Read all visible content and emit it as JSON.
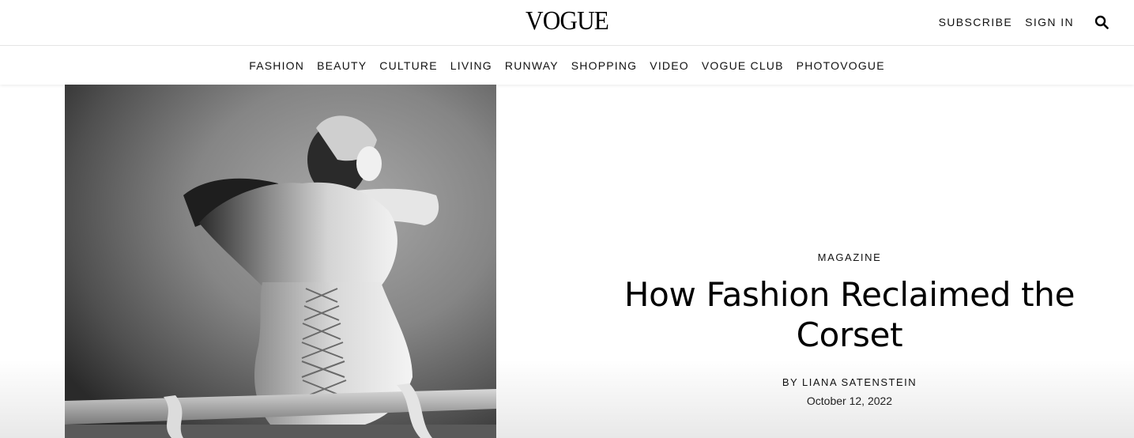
{
  "header": {
    "logo": "VOGUE",
    "subscribe_label": "SUBSCRIBE",
    "signin_label": "SIGN IN",
    "search_icon": "search-icon"
  },
  "nav": {
    "items": [
      {
        "label": "FASHION"
      },
      {
        "label": "BEAUTY"
      },
      {
        "label": "CULTURE"
      },
      {
        "label": "LIVING"
      },
      {
        "label": "RUNWAY"
      },
      {
        "label": "SHOPPING"
      },
      {
        "label": "VIDEO"
      },
      {
        "label": "VOGUE CLUB"
      },
      {
        "label": "PHOTOVOGUE"
      }
    ]
  },
  "article": {
    "rubric": "MAGAZINE",
    "headline": "How Fashion Reclaimed the Corset",
    "byline_prefix": "BY",
    "author": "LIANA SATENSTEIN",
    "date": "October 12, 2022"
  }
}
